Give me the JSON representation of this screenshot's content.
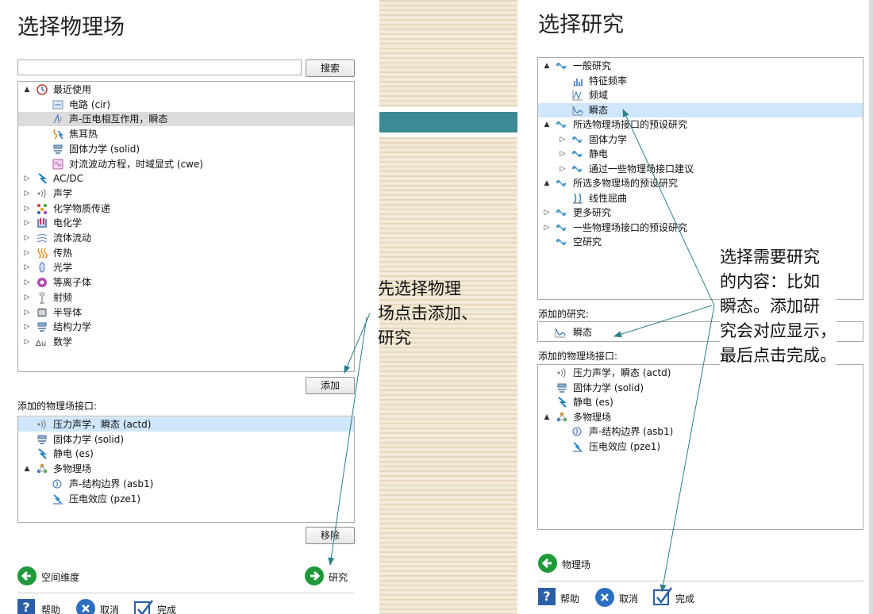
{
  "left": {
    "title": "选择物理场",
    "search_value": "",
    "search_button": "搜索",
    "tree": [
      {
        "label": "最近使用",
        "icon": "recent-clock-icon",
        "level": 0,
        "expander": "▲"
      },
      {
        "label": "电路 (cir)",
        "icon": "circuit-icon",
        "level": 1
      },
      {
        "label": "声-压电相互作用，瞬态",
        "icon": "acoustic-piezo-icon",
        "level": 1,
        "selected": true
      },
      {
        "label": "焦耳热",
        "icon": "joule-heat-icon",
        "level": 1
      },
      {
        "label": "固体力学 (solid)",
        "icon": "solid-mechanics-icon",
        "level": 1
      },
      {
        "label": "对流波动方程，时域显式 (cwe)",
        "icon": "wave-equation-icon",
        "level": 1
      },
      {
        "label": "AC/DC",
        "icon": "acdc-icon",
        "level": 0,
        "expander": "▷"
      },
      {
        "label": "声学",
        "icon": "acoustics-icon",
        "level": 0,
        "expander": "▷"
      },
      {
        "label": "化学物质传递",
        "icon": "chemical-icon",
        "level": 0,
        "expander": "▷"
      },
      {
        "label": "电化学",
        "icon": "electrochem-icon",
        "level": 0,
        "expander": "▷"
      },
      {
        "label": "流体流动",
        "icon": "fluid-flow-icon",
        "level": 0,
        "expander": "▷"
      },
      {
        "label": "传热",
        "icon": "heat-transfer-icon",
        "level": 0,
        "expander": "▷"
      },
      {
        "label": "光学",
        "icon": "optics-icon",
        "level": 0,
        "expander": "▷"
      },
      {
        "label": "等离子体",
        "icon": "plasma-icon",
        "level": 0,
        "expander": "▷"
      },
      {
        "label": "射频",
        "icon": "rf-icon",
        "level": 0,
        "expander": "▷"
      },
      {
        "label": "半导体",
        "icon": "semiconductor-icon",
        "level": 0,
        "expander": "▷"
      },
      {
        "label": "结构力学",
        "icon": "structural-icon",
        "level": 0,
        "expander": "▷"
      },
      {
        "label": "数学",
        "icon": "math-icon",
        "level": 0,
        "expander": "▷"
      }
    ],
    "add_button": "添加",
    "added_label": "添加的物理场接口:",
    "added": [
      {
        "label": "压力声学，瞬态 (actd)",
        "icon": "pressure-acoustics-icon",
        "level": 0,
        "selected": true
      },
      {
        "label": "固体力学 (solid)",
        "icon": "solid-mechanics-icon",
        "level": 0
      },
      {
        "label": "静电 (es)",
        "icon": "electrostatics-icon",
        "level": 0
      },
      {
        "label": "多物理场",
        "icon": "multiphysics-icon",
        "level": 0,
        "expander": "▲"
      },
      {
        "label": "声-结构边界 (asb1)",
        "icon": "acoustic-structure-icon",
        "level": 1
      },
      {
        "label": "压电效应 (pze1)",
        "icon": "piezo-effect-icon",
        "level": 1
      }
    ],
    "remove_button": "移除",
    "nav_left": "空间维度",
    "nav_right": "研究",
    "help": "帮助",
    "cancel": "取消",
    "done": "完成"
  },
  "annotation_left": [
    "先选择物理",
    "场点击添加、",
    "研究"
  ],
  "right": {
    "title": "选择研究",
    "tree": [
      {
        "label": "一般研究",
        "icon": "study-group-icon",
        "level": 0,
        "expander": "▲"
      },
      {
        "label": "特征频率",
        "icon": "eigenfrequency-icon",
        "level": 1
      },
      {
        "label": "频域",
        "icon": "frequency-domain-icon",
        "level": 1
      },
      {
        "label": "瞬态",
        "icon": "transient-icon",
        "level": 1,
        "selected": true
      },
      {
        "label": "所选物理场接口的预设研究",
        "icon": "study-group-icon",
        "level": 0,
        "expander": "▲"
      },
      {
        "label": "固体力学",
        "icon": "study-group-icon",
        "level": 1,
        "expander": "▷"
      },
      {
        "label": "静电",
        "icon": "study-group-icon",
        "level": 1,
        "expander": "▷"
      },
      {
        "label": "通过一些物理场接口建议",
        "icon": "study-group-icon",
        "level": 1,
        "expander": "▷"
      },
      {
        "label": "所选多物理场的预设研究",
        "icon": "study-group-icon",
        "level": 0,
        "expander": "▲"
      },
      {
        "label": "线性屈曲",
        "icon": "linear-buckling-icon",
        "level": 1
      },
      {
        "label": "更多研究",
        "icon": "study-group-icon",
        "level": 0,
        "expander": "▷"
      },
      {
        "label": "一些物理场接口的预设研究",
        "icon": "study-group-icon",
        "level": 0,
        "expander": "▷"
      },
      {
        "label": "空研究",
        "icon": "study-group-icon",
        "level": 0
      }
    ],
    "added_study_label": "添加的研究:",
    "added_study": "瞬态",
    "added_physics_label": "添加的物理场接口:",
    "added": [
      {
        "label": "压力声学，瞬态 (actd)",
        "icon": "pressure-acoustics-icon",
        "level": 0
      },
      {
        "label": "固体力学 (solid)",
        "icon": "solid-mechanics-icon",
        "level": 0
      },
      {
        "label": "静电 (es)",
        "icon": "electrostatics-icon",
        "level": 0
      },
      {
        "label": "多物理场",
        "icon": "multiphysics-icon",
        "level": 0,
        "expander": "▲"
      },
      {
        "label": "声-结构边界 (asb1)",
        "icon": "acoustic-structure-icon",
        "level": 1
      },
      {
        "label": "压电效应 (pze1)",
        "icon": "piezo-effect-icon",
        "level": 1
      }
    ],
    "nav_left": "物理场",
    "help": "帮助",
    "cancel": "取消",
    "done": "完成"
  },
  "annotation_right": [
    "选择需要研究",
    "的内容：比如",
    "瞬态。添加研",
    "究会对应显示，",
    "最后点击完成。"
  ],
  "colors": {
    "accent_green": "#1e9a3a",
    "select_blue": "#cfe6fb",
    "arrow": "#2a7f8a"
  }
}
